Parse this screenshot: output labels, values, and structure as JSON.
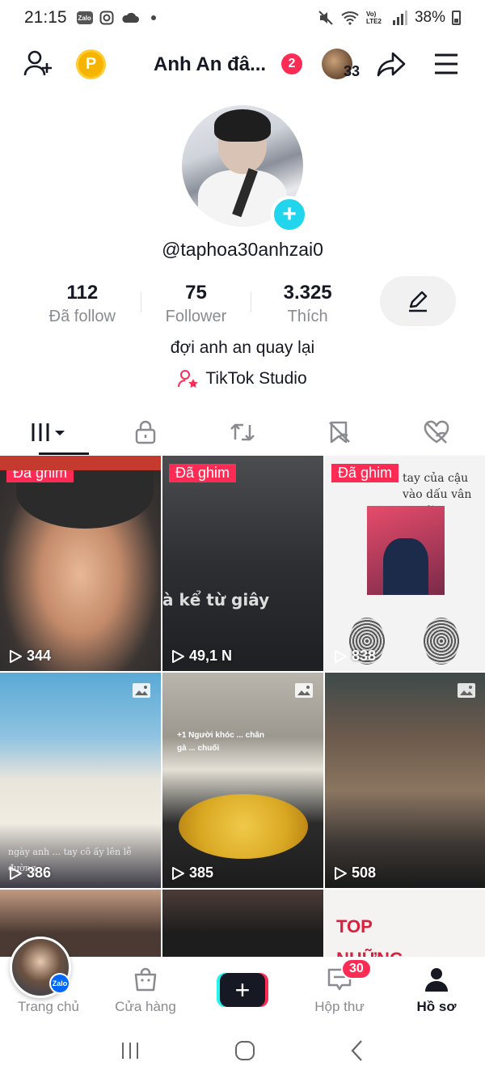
{
  "status_bar": {
    "time": "21:15",
    "zalo_label": "Zalo",
    "network_label": "Vo) LTE2",
    "battery": "38%"
  },
  "header": {
    "title": "Anh An đâ...",
    "notification_count": "2",
    "friends_count": "33"
  },
  "profile": {
    "username": "@taphoa30anhzai0",
    "bio": "đợi anh an quay lại",
    "studio_label": "TikTok Studio",
    "stats": [
      {
        "value": "112",
        "label": "Đã follow"
      },
      {
        "value": "75",
        "label": "Follower"
      },
      {
        "value": "3.325",
        "label": "Thích"
      }
    ]
  },
  "tabs": [
    {
      "name": "videos",
      "icon": "grid-bars-icon",
      "active": true
    },
    {
      "name": "private",
      "icon": "lock-icon"
    },
    {
      "name": "reposts",
      "icon": "repost-icon"
    },
    {
      "name": "favorites",
      "icon": "bookmark-hidden-icon"
    },
    {
      "name": "liked",
      "icon": "heart-hidden-icon"
    }
  ],
  "videos": [
    {
      "pinned_label": "Đã ghim",
      "views": "344"
    },
    {
      "pinned_label": "Đã ghim",
      "views": "49,1 N",
      "caption": "à kể từ giây"
    },
    {
      "pinned_label": "Đã ghim",
      "views": "838",
      "caption": "tay của cậu vào dấu vân tay đi"
    },
    {
      "views": "386",
      "caption": "ngày anh ... tay cô ấy lên lễ đường"
    },
    {
      "views": "385",
      "caption": "+1 Người khóc ... chân gà ... chuối"
    },
    {
      "views": "508"
    },
    {},
    {},
    {
      "caption": "TOP NHỮNG"
    }
  ],
  "bottom_nav": {
    "home": "Trang chủ",
    "shop": "Cửa hàng",
    "inbox": "Hộp thư",
    "inbox_badge": "30",
    "profile": "Hồ sơ",
    "float_badge": "Zalo"
  },
  "colors": {
    "accent": "#fe2c55",
    "cyan": "#25f4ee",
    "text": "#161823",
    "secondary_text": "#8a8b91"
  }
}
